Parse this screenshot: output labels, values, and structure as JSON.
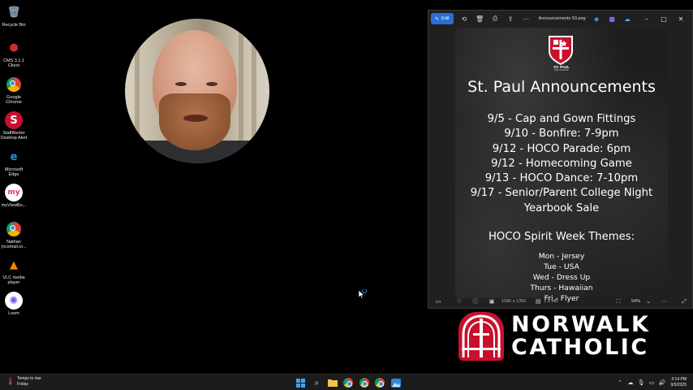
{
  "desktop": {
    "icons": [
      {
        "name": "recycle-bin",
        "label": "Recycle Bin",
        "glyph": "🗑",
        "color": "#8aa0b8"
      },
      {
        "name": "cms-client",
        "label": "CMS 3.1.1\nClient",
        "glyph": "⬢",
        "color": "#d12b2b"
      },
      {
        "name": "google-chrome",
        "label": "Google\nChrome",
        "glyph": "",
        "color": "#4285f4"
      },
      {
        "name": "staffalerter",
        "label": "StaffAlerter\nDesktop Alert",
        "glyph": "S",
        "color": "#c8102e"
      },
      {
        "name": "microsoft-edge",
        "label": "Microsoft\nEdge",
        "glyph": "e",
        "color": "#1f9bd8"
      },
      {
        "name": "myviewboard",
        "label": "myViewBo...",
        "glyph": "my",
        "color": "#e23a4b"
      },
      {
        "name": "chrome-profile",
        "label": "Nathan\n(ncsmail.or...",
        "glyph": "",
        "color": "#4285f4"
      },
      {
        "name": "vlc-media-player",
        "label": "VLC media\nplayer",
        "glyph": "▲",
        "color": "#f08a00"
      },
      {
        "name": "loom",
        "label": "Loom",
        "glyph": "✺",
        "color": "#625df5"
      }
    ]
  },
  "viewer": {
    "edit_label": "Edit",
    "filename": "Announcements 93.png",
    "status": {
      "dimensions": "1080 x 1350",
      "filesize": "1.3 MB",
      "zoom": "54%"
    },
    "poster": {
      "school": "ST. PAUL",
      "school_sub": "HIGH SCHOOL",
      "title": "St. Paul Announcements",
      "events": [
        "9/5 - Cap and Gown Fittings",
        "9/10 - Bonfire: 7-9pm",
        "9/12 - HOCO Parade: 6pm",
        "9/12 - Homecoming Game",
        "9/13 - HOCO Dance: 7-10pm",
        "9/17 - Senior/Parent College Night",
        "Yearbook Sale"
      ],
      "spirit_title": "HOCO Spirit Week Themes:",
      "themes": [
        "Mon - Jersey",
        "Tue - USA",
        "Wed - Dress Up",
        "Thurs - Hawaiian",
        "Fri - Flyer"
      ]
    }
  },
  "logo": {
    "line1": "NORWALK",
    "line2": "CATHOLIC",
    "color": "#c8102e"
  },
  "taskbar": {
    "weather_line1": "Temps to rise",
    "weather_line2": "Friday",
    "time": "3:14 PM",
    "date": "9/5/2025"
  }
}
